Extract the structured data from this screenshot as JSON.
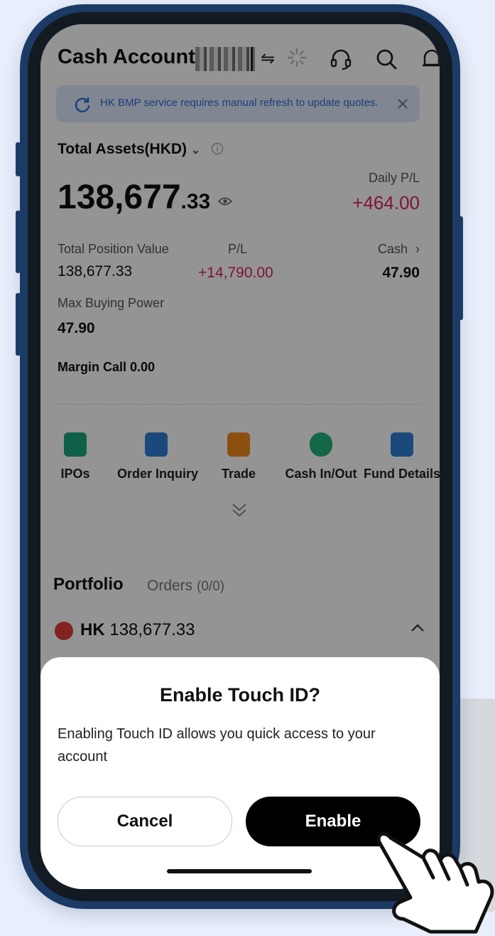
{
  "header": {
    "title": "Cash Account",
    "swap_icon": "⇋"
  },
  "banner": {
    "text": "HK BMP service requires manual refresh to update quotes."
  },
  "assets": {
    "label": "Total Assets(HKD)",
    "caret": "⌄",
    "amount_main": "138,677",
    "amount_decimal": ".33",
    "daily_pl_label": "Daily P/L",
    "daily_pl_value": "+464.00"
  },
  "metrics": {
    "position_label": "Total Position Value",
    "position_value": "138,677.33",
    "pl_label": "P/L",
    "pl_value": "+14,790.00",
    "cash_label": "Cash",
    "cash_chevron": "›",
    "cash_value": "47.90",
    "buying_power_label": "Max Buying Power",
    "buying_power_value": "47.90",
    "margin_call": "Margin Call 0.00"
  },
  "quick_actions": [
    {
      "label": "IPOs",
      "icon": "ipo-bag-icon",
      "color": "#1aa57c"
    },
    {
      "label": "Order Inquiry",
      "icon": "order-list-icon",
      "color": "#2f7fd6"
    },
    {
      "label": "Trade",
      "icon": "trade-icon",
      "color": "#f08a1c"
    },
    {
      "label": "Cash In/Out",
      "icon": "cash-globe-icon",
      "color": "#20b27a"
    },
    {
      "label": "Fund Details",
      "icon": "fund-clock-icon",
      "color": "#2f7fd6"
    }
  ],
  "expand_chevron": "⌄",
  "portfolio": {
    "tab_portfolio": "Portfolio",
    "tab_orders": "Orders",
    "orders_count": "(0/0)",
    "market": "HK",
    "market_value": "138,677.33",
    "collapse_chevron": "^"
  },
  "dialog": {
    "title": "Enable Touch ID?",
    "message": "Enabling Touch ID allows you quick access to your account",
    "cancel": "Cancel",
    "enable": "Enable"
  },
  "colors": {
    "frame": "#1b3a64",
    "background": "#e8eefb",
    "negative_pink": "#d9255a",
    "banner_blue": "#2f6bd1",
    "primary_button": "#000000"
  }
}
